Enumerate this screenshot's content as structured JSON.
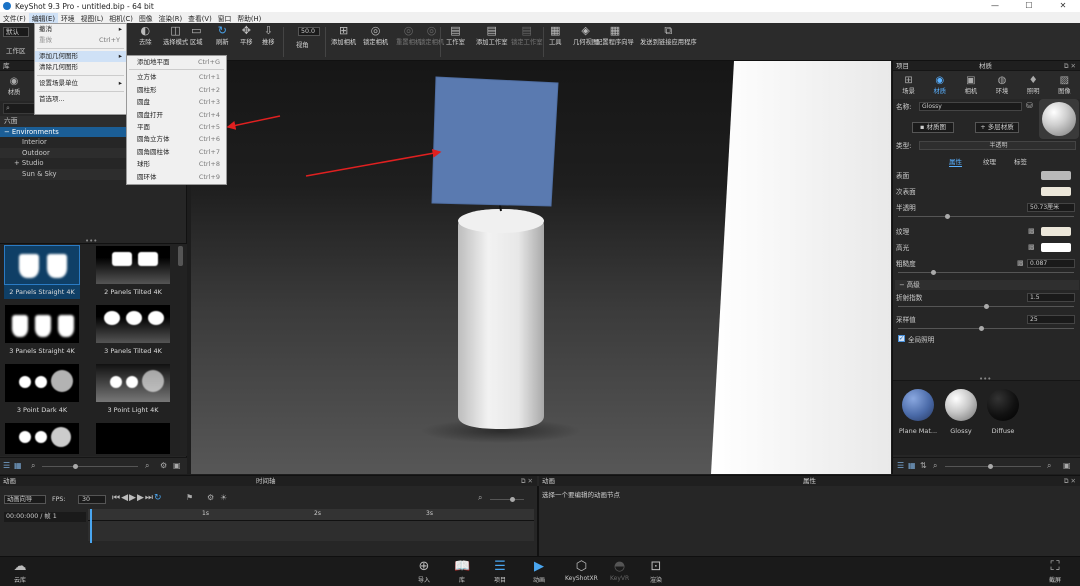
{
  "titlebar": {
    "title": "KeyShot 9.3 Pro  - untitled.bip  - 64 bit"
  },
  "menubar": {
    "items": [
      "文件(F)",
      "编辑(E)",
      "环境",
      "视图(L)",
      "相机(C)",
      "图像",
      "渲染(R)",
      "查看(V)",
      "窗口",
      "帮助(H)"
    ]
  },
  "toolbar": {
    "workspace_select": "默认",
    "workspace_label": "工作区",
    "fov_value": "50.0",
    "buttons": [
      "去除",
      "选择模式",
      "区域",
      "刷新",
      "平移",
      "推移",
      "视角",
      "添加相机",
      "锁定相机",
      "重置相机",
      "锁定相机",
      "工作室",
      "添加工作室",
      "锁定工作室",
      "工具",
      "几何视图",
      "配置程序向导",
      "发送到链接应用程序"
    ]
  },
  "edit_menu": {
    "items": [
      {
        "label": "撤消",
        "shortcut": "",
        "submenu": true,
        "dim": false
      },
      {
        "label": "重做",
        "shortcut": "Ctrl+Y",
        "dim": true
      },
      {
        "label": "添加几何图形",
        "submenu": true,
        "highlight": true
      },
      {
        "label": "清除几何图形",
        "dim": false
      },
      {
        "label": "设置场景单位",
        "submenu": true
      },
      {
        "label": "首选项...",
        "dim": false
      }
    ]
  },
  "geometry_menu": {
    "items": [
      {
        "label": "添加地平面",
        "shortcut": "Ctrl+G"
      },
      {
        "label": "立方体",
        "shortcut": "Ctrl+1"
      },
      {
        "label": "圆柱形",
        "shortcut": "Ctrl+2"
      },
      {
        "label": "圆盘",
        "shortcut": "Ctrl+3"
      },
      {
        "label": "圆盘打开",
        "shortcut": "Ctrl+4"
      },
      {
        "label": "平面",
        "shortcut": "Ctrl+5"
      },
      {
        "label": "圆角立方体",
        "shortcut": "Ctrl+6"
      },
      {
        "label": "圆角圆柱体",
        "shortcut": "Ctrl+7"
      },
      {
        "label": "球形",
        "shortcut": "Ctrl+8"
      },
      {
        "label": "圆环体",
        "shortcut": "Ctrl+9"
      }
    ]
  },
  "library": {
    "header": "库",
    "tabs": [
      "材质",
      "颜色",
      "纹理",
      "环境",
      "背景",
      "收藏夹"
    ],
    "tree": [
      {
        "label": "六面"
      },
      {
        "label": "Environments",
        "selected": true
      },
      {
        "label": "Interior"
      },
      {
        "label": "Outdoor"
      },
      {
        "label": "Studio"
      },
      {
        "label": "Sun & Sky"
      }
    ],
    "thumbs": [
      "2 Panels Straight 4K",
      "2 Panels Tilted 4K",
      "3 Panels Straight 4K",
      "3 Panels Tilted 4K",
      "3 Point Dark 4K",
      "3 Point Light 4K",
      "",
      ""
    ]
  },
  "project": {
    "header_left": "项目",
    "header_right": "材质",
    "tabs": [
      "场景",
      "材质",
      "相机",
      "环境",
      "照明",
      "图像"
    ],
    "name_label": "名称:",
    "name_value": "Glossy",
    "graph_btn": "材质图",
    "multi_btn": "多层材质",
    "type_label": "类型:",
    "type_value": "半透明",
    "subtabs": [
      "属性",
      "纹理",
      "标签"
    ],
    "props": [
      {
        "label": "表面",
        "kind": "swatch",
        "color": "#b9b9b9"
      },
      {
        "label": "次表面",
        "kind": "swatch",
        "color": "#ece7da"
      },
      {
        "label": "半透明",
        "kind": "value",
        "value": "50.73厘米"
      },
      {
        "label": "纹理",
        "kind": "swatch",
        "color": "#ece7da"
      },
      {
        "label": "高光",
        "kind": "swatch",
        "color": "#ffffff"
      },
      {
        "label": "粗糙度",
        "kind": "value",
        "value": "0.087"
      }
    ],
    "advanced_label": "高级",
    "ior_label": "折射指数",
    "ior_value": "1.5",
    "samples_label": "采样值",
    "samples_value": "25",
    "checkbox_label": "全局照明",
    "materials": [
      {
        "name": "Plane Mat...",
        "color": "#4a6aa8"
      },
      {
        "name": "Glossy",
        "color": "#c8c8c8"
      },
      {
        "name": "Diffuse",
        "color": "#111111"
      }
    ]
  },
  "animation": {
    "header": "动画",
    "timeline_label": "时间轴",
    "wizard_btn": "动画向导",
    "fps_label": "FPS:",
    "fps_value": "30",
    "time": "00:00:000 / 帧 1",
    "ticks": [
      "1s",
      "2s",
      "3s"
    ],
    "panel_header": "动画",
    "props_header": "属性",
    "hint": "选择一个要编辑的动画节点"
  },
  "dock": {
    "items": [
      "云库",
      "导入",
      "库",
      "项目",
      "动画",
      "KeyShotXR",
      "KeyVR",
      "渲染",
      "截屏"
    ]
  }
}
